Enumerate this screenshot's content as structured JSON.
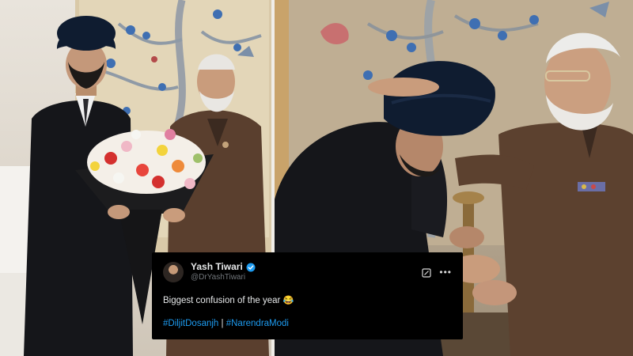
{
  "tweet": {
    "display_name": "Yash Tiwari",
    "handle": "@DrYashTiwari",
    "text": "Biggest confusion of the year",
    "emoji": "😂",
    "hashtags": [
      "#DiljitDosanjh",
      "#NarendraModi"
    ],
    "separator": "|"
  },
  "colors": {
    "link": "#1d9bf0",
    "verified": "#1d9bf0",
    "card_background": "#000000"
  },
  "icons": [
    "verified-badge-icon",
    "grok-icon",
    "more-icon"
  ]
}
